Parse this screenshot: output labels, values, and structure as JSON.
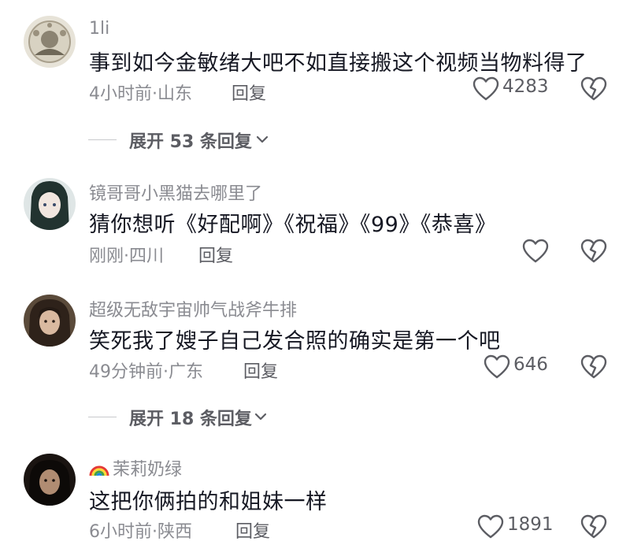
{
  "comments": [
    {
      "username": "1li",
      "text": "事到如今金敏绪大吧不如直接搬这个视频当物料得了",
      "time_location": "4小时前·山东",
      "reply_label": "回复",
      "likes": "4283",
      "avatar": "ornate-emblem-avatar"
    },
    {
      "username": "镜哥哥小黑猫去哪里了",
      "text": "猜你想听《好配啊》《祝福》《99》《恭喜》",
      "time_location": "刚刚·四川",
      "reply_label": "回复",
      "likes": "",
      "avatar": "anime-girl-avatar"
    },
    {
      "username": "超级无敌宇宙帅气战斧牛排",
      "text": "笑死我了嫂子自己发合照的确实是第一个吧",
      "time_location": "49分钟前·广东",
      "reply_label": "回复",
      "likes": "646",
      "avatar": "girl-portrait-avatar"
    },
    {
      "username": "茉莉奶绿",
      "username_prefix_icon": "rainbow-icon",
      "text": "这把你俩拍的和姐妹一样",
      "time_location": "6小时前·陕西",
      "reply_label": "回复",
      "likes": "1891",
      "avatar": "dark-portrait-avatar"
    }
  ],
  "expand_replies": [
    {
      "label": "展开 53 条回复"
    },
    {
      "label": "展开 18 条回复"
    }
  ],
  "colors": {
    "text_primary": "#161823",
    "text_secondary": "#8a8b91",
    "action_gray": "#5c5d63"
  }
}
